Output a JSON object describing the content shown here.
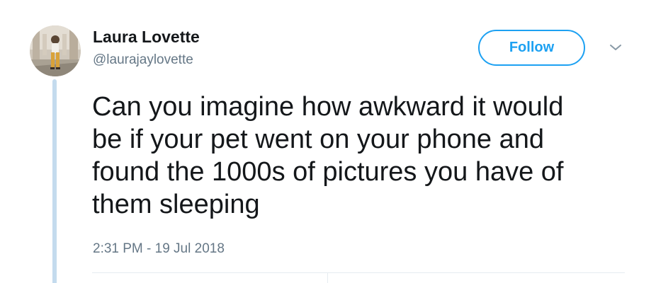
{
  "author": {
    "display_name": "Laura Lovette",
    "handle": "@laurajaylovette",
    "avatar_icon": "profile-photo"
  },
  "actions": {
    "follow_label": "Follow",
    "menu_icon": "chevron-down-icon"
  },
  "tweet": {
    "lines": [
      "Can you imagine how awkward it would",
      "be if your pet went on your phone and",
      "found the 1000s of pictures you have of",
      "them sleeping"
    ],
    "timestamp": "2:31 PM - 19 Jul 2018"
  },
  "colors": {
    "accent": "#1da1f2",
    "text_primary": "#14171a",
    "text_secondary": "#657786",
    "thread_line": "#c4dbee",
    "divider": "#e6ecf0"
  }
}
